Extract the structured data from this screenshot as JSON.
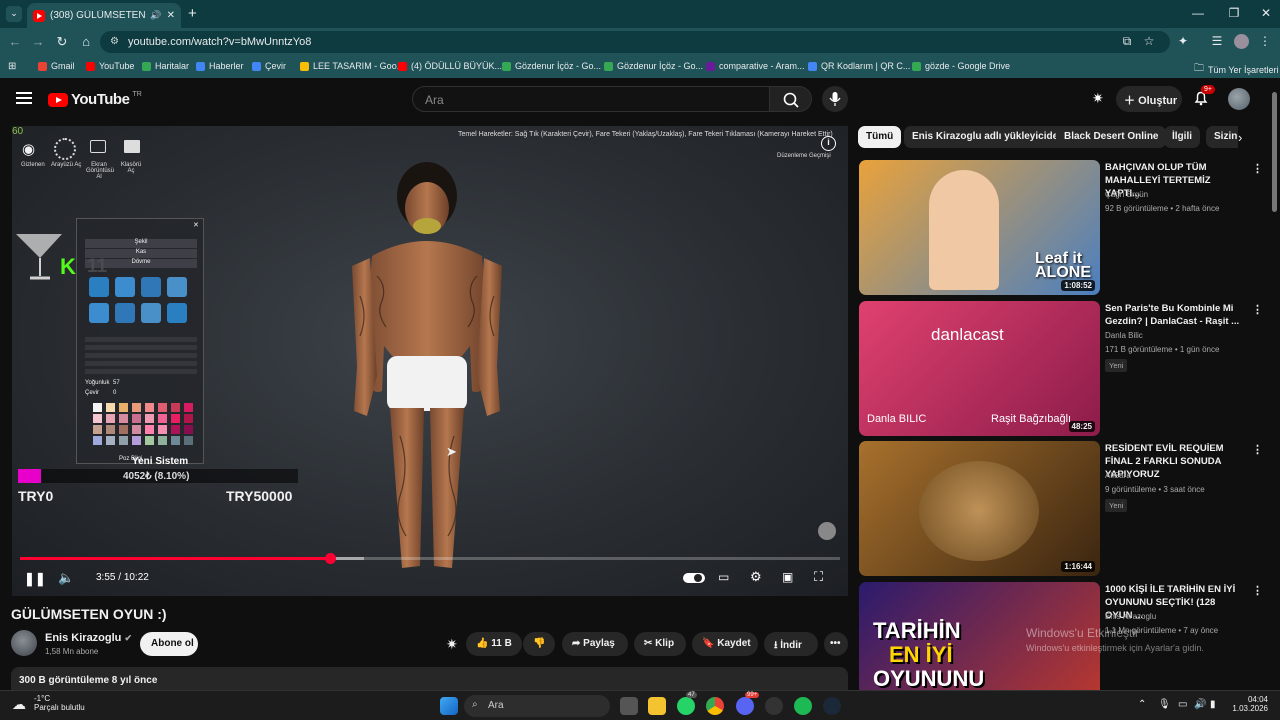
{
  "browser": {
    "tab_title": "(308) GÜLÜMSETEN OYUN",
    "url": "youtube.com/watch?v=bMwUnntzYo8",
    "bookmarks": [
      {
        "label": "Gmail",
        "color": "#ea4335"
      },
      {
        "label": "YouTube",
        "color": "#ff0000"
      },
      {
        "label": "Haritalar",
        "color": "#34a853"
      },
      {
        "label": "Haberler",
        "color": "#4285f4"
      },
      {
        "label": "Çevir",
        "color": "#4285f4"
      },
      {
        "label": "LEE TASARIM - Goo...",
        "color": "#fbbc04"
      },
      {
        "label": "(4) ÖDÜLLÜ BÜYÜK...",
        "color": "#ff0000"
      },
      {
        "label": "Gözdenur İçöz - Go...",
        "color": "#34a853"
      },
      {
        "label": "Gözdenur İçöz - Go...",
        "color": "#34a853"
      },
      {
        "label": "comparative - Aram...",
        "color": "#6a1b9a"
      },
      {
        "label": "QR Kodlarım | QR C...",
        "color": "#4285f4"
      },
      {
        "label": "gözde - Google Drive",
        "color": "#34a853"
      }
    ],
    "all_bookmarks": "Tüm Yer İşaretleri"
  },
  "youtube": {
    "logo_word": "YouTube",
    "logo_country": "TR",
    "search_placeholder": "Ara",
    "create_label": "Oluştur",
    "notif_count": "9+"
  },
  "player": {
    "fps": "60",
    "hud_buttons": [
      "Gizlenen",
      "Arayüzü Aç",
      "Ekran Görüntüsü Al",
      "Klasörü Aç"
    ],
    "hint_text": "Temel Hareketler: Sağ Tık (Karakteri Çevir), Fare Tekeri (Yaklaş/Uzaklaş), Fare Tekeri Tıklaması (Kamerayı Hareket Ettir)",
    "history_label": "Düzenleme Geçmişi",
    "panel_rows": [
      "Şekil",
      "Kas",
      "Dövme"
    ],
    "panel_labels": [
      "Yoğunluk",
      "Çevir"
    ],
    "panel_values": [
      "57",
      "0"
    ],
    "panel_footer": "Poz Bilgi",
    "counter_letter": "K",
    "counter_value": "11",
    "goal_title": "Yeni Sistem",
    "goal_amount": "4052₺ (8.10%)",
    "goal_min": "TRY0",
    "goal_max": "TRY50000",
    "goal_progress": 0.081,
    "time_current": "3:55",
    "time_total": "10:22",
    "played_fraction": 0.378,
    "loaded_fraction": 0.42
  },
  "video": {
    "title": "GÜLÜMSETEN OYUN :)",
    "channel": "Enis Kirazoglu",
    "subscribers": "1,58 Mn abone",
    "subscribe_label": "Abone ol",
    "likes": "11 B",
    "share_label": "Paylaş",
    "clip_label": "Klip",
    "save_label": "Kaydet",
    "download_label": "İndir",
    "views_date": "300 B görüntüleme  8 yıl önce"
  },
  "chips": [
    "Tümü",
    "Enis Kirazoglu adlı yükleyiciden",
    "Black Desert Online",
    "İlgili",
    "Sizin için"
  ],
  "related": [
    {
      "title": "BAHÇIVAN OLUP TÜM MAHALLEYİ TERTEMİZ YAPTI...",
      "channel": "Çağrı Ergün",
      "meta": "92 B görüntüleme • 2 hafta önce",
      "duration": "1:08:52",
      "new": "",
      "thumb_colors": [
        "#e9a23b",
        "#4a7fc0"
      ]
    },
    {
      "title": "Sen Paris'te Bu Kombinle Mi Gezdin? | DanlaCast - Raşit ...",
      "channel": "Danla Bilic",
      "meta": "171 B görüntüleme • 1 gün önce",
      "duration": "48:25",
      "new": "Yeni",
      "thumb_colors": [
        "#e0416f",
        "#8c1c4a"
      ]
    },
    {
      "title": "RESİDENT EVİL REQUİEM FİNAL 2 FARKLI SONUDA YAPIYORUZ",
      "channel": "AliSara",
      "meta": "9 görüntüleme • 3 saat önce",
      "duration": "1:16:44",
      "new": "Yeni",
      "thumb_colors": [
        "#a8712d",
        "#3a2510"
      ]
    },
    {
      "title": "1000 KİŞİ İLE TARİHİN EN İYİ OYUNUNU SEÇTİK! (128 OYUN ...",
      "channel": "Enis Kirazoglu",
      "meta": "1,1 Mn görüntüleme • 7 ay önce",
      "duration": "",
      "new": "",
      "thumb_colors": [
        "#2b1b6e",
        "#c0392b"
      ]
    }
  ],
  "thumb_text": {
    "danlacast": "danlacast",
    "danla": "Danla BILIC",
    "rasit": "Raşit Bağzıbağlı",
    "leaf": "Leaf it ALONE",
    "tarihin": "TARİHİN",
    "en_iyi": "EN İYİ",
    "oyununu": "OYUNUNU"
  },
  "windows": {
    "activate_title": "Windows'u Etkinleştir",
    "activate_sub": "Windows'u etkinleştirmek için Ayarlar'a gidin.",
    "weather_temp": "-1°C",
    "weather_desc": "Parçalı bulutlu",
    "search_label": "Ara",
    "time": "04:04",
    "date": "1.03.2026",
    "badge_counts": [
      "47",
      "99+"
    ]
  }
}
